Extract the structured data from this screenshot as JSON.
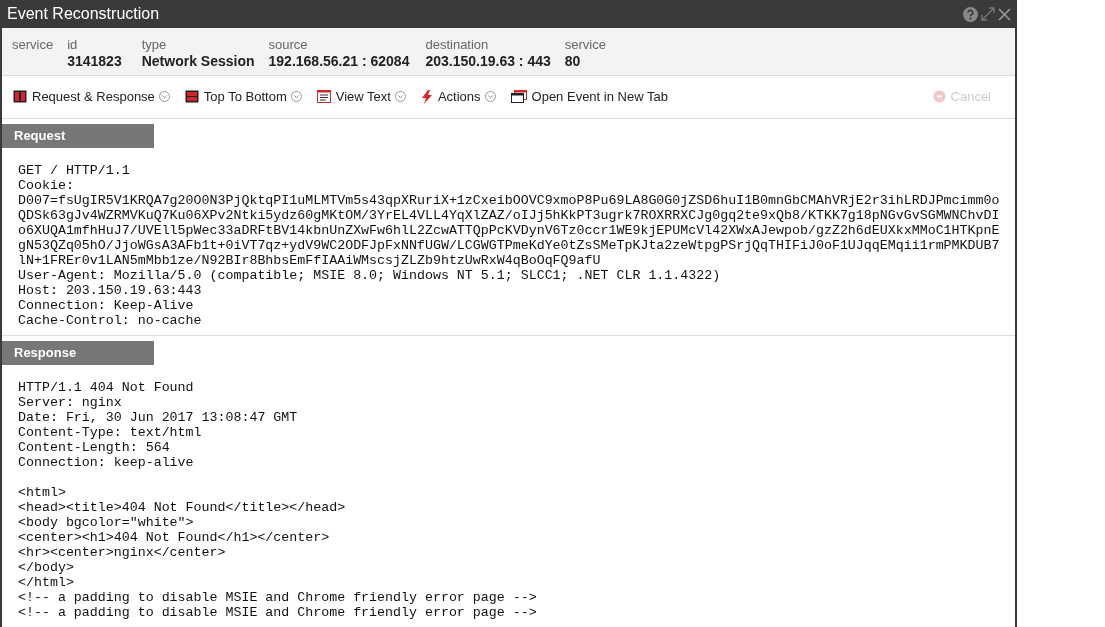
{
  "window": {
    "title": "Event Reconstruction"
  },
  "header": [
    {
      "label": "service"
    },
    {
      "label": "id",
      "value": "3141823"
    },
    {
      "label": "type",
      "value": "Network Session"
    },
    {
      "label": "source",
      "value": "192.168.56.21 : 62084"
    },
    {
      "label": "destination",
      "value": "203.150.19.63 : 443"
    },
    {
      "label": "service",
      "value": "80"
    }
  ],
  "toolbar": [
    {
      "kind": "columns",
      "label": "Request & Response",
      "dropdown": true
    },
    {
      "kind": "rows",
      "label": "Top To Bottom",
      "dropdown": true
    },
    {
      "kind": "text",
      "label": "View Text",
      "dropdown": true
    },
    {
      "kind": "bolt",
      "label": "Actions",
      "dropdown": true
    },
    {
      "kind": "tab",
      "label": "Open Event in New Tab",
      "dropdown": false
    }
  ],
  "cancel": {
    "label": "Cancel",
    "disabled": true
  },
  "sections": [
    {
      "title": "Request",
      "blocks": [
        [
          "GET / HTTP/1.1",
          "Cookie:",
          "D007=fsUgIR5V1KRQA7g20O0N3PjQktqPI1uMLMTVm5s43qpXRuriX+1zCxeibOOVC9xmoP8Pu69LA8G0G0jZSD6huI1B0mnGbCMAhVRjE2r3ihLRDJPmcimm0o",
          "QDSk63gJv4WZRMVKuQ7Ku06XPv2Ntki5ydz60gMKtOM/3YrEL4VLL4YqXlZAZ/oIJj5hKkPT3ugrk7ROXRRXCJg0gq2te9xQb8/KTKK7g18pNGvGvSGMWNChvDI",
          "o6XUQA1mfhHuJ7/UVEll5pWec33aDRFtBV14kbnUnZXwFw6hlL2ZcwATTQpPcKVDynV6Tz0ccr1WE9kjEPUMcVl42XWxAJewpob/gzZ2h6dEUXkxMMoC1HTKpnE",
          "gN53QZq05hO/JjoWGsA3AFb1t+0iVT7qz+ydV9WC2ODFJpFxNNfUGW/LCGWGTPmeKdYe0tZsSMeTpKJta2zeWtpgPSrjQqTHIFiJ0oF1UJqqEMqii1rmPMKDUB7",
          "lN+1FREr0v1LAN5mMbb1ze/N92BIr8BhbsEmFfIAAiWMscsjZLZb9htzUwRxW4qBoOqFQ9afU",
          "User-Agent: Mozilla/5.0 (compatible; MSIE 8.0; Windows NT 5.1; SLCC1; .NET CLR 1.1.4322)",
          "Host: 203.150.19.63:443",
          "Connection: Keep-Alive",
          "Cache-Control: no-cache"
        ]
      ]
    },
    {
      "title": "Response",
      "blocks": [
        [
          "HTTP/1.1 404 Not Found",
          "Server: nginx",
          "Date: Fri, 30 Jun 2017 13:08:47 GMT",
          "Content-Type: text/html",
          "Content-Length: 564",
          "Connection: keep-alive"
        ],
        [
          "<html>",
          "<head><title>404 Not Found</title></head>",
          "<body bgcolor=\"white\">",
          "<center><h1>404 Not Found</h1></center>",
          "<hr><center>nginx</center>",
          "</body>",
          "</html>",
          "<!-- a padding to disable MSIE and Chrome friendly error page -->",
          "<!-- a padding to disable MSIE and Chrome friendly error page -->"
        ]
      ]
    }
  ]
}
